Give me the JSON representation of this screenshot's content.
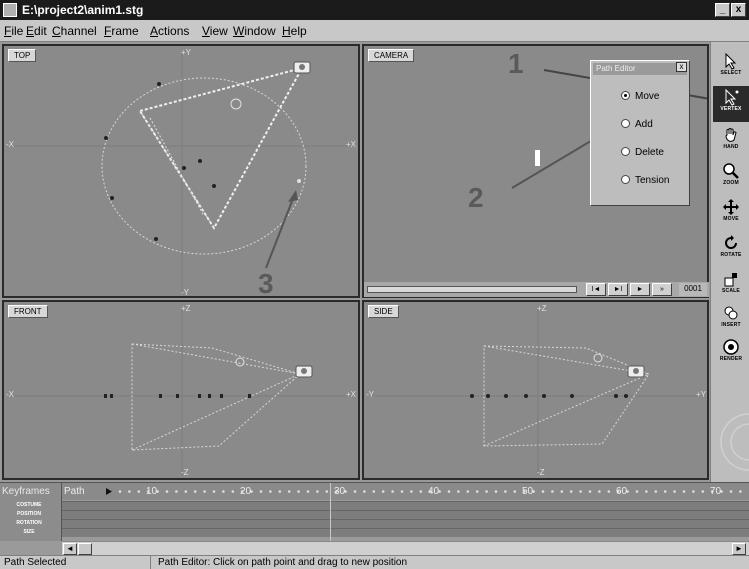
{
  "window": {
    "title": "E:\\project2\\anim1.stg",
    "minimize_glyph": "_",
    "close_glyph": "x"
  },
  "menu": [
    "File",
    "Edit",
    "Channel",
    "Frame",
    "Actions",
    "View",
    "Window",
    "Help"
  ],
  "viewports": {
    "top": {
      "label": "TOP",
      "axis_top": "+Y",
      "axis_bottom": "-Y",
      "axis_left": "-X",
      "axis_right": "+X"
    },
    "camera": {
      "label": "CAMERA"
    },
    "front": {
      "label": "FRONT",
      "axis_top": "+Z",
      "axis_bottom": "-Z",
      "axis_left": "-X",
      "axis_right": "+X"
    },
    "side": {
      "label": "SIDE",
      "axis_top": "+Z",
      "axis_bottom": "-Z",
      "axis_left": "-Y",
      "axis_right": "+Y"
    }
  },
  "callouts": [
    "1",
    "2",
    "3"
  ],
  "path_editor": {
    "title": "Path Editor",
    "close_glyph": "x",
    "options": [
      "Move",
      "Add",
      "Delete",
      "Tension"
    ],
    "selected": "Move"
  },
  "camera_timeline": {
    "frame": "0001",
    "buttons": [
      "I◄",
      "►I",
      "►",
      "»"
    ]
  },
  "toolbar": {
    "tools": [
      "SELECT",
      "VERTEX",
      "HAND",
      "ZOOM",
      "MOVE",
      "ROTATE",
      "SCALE",
      "INSERT",
      "RENDER"
    ],
    "active": "VERTEX"
  },
  "keyframes": {
    "title": "Keyframes",
    "tracks": [
      "COSTUME",
      "POSITION",
      "ROTATION",
      "SIZE"
    ],
    "path_label": "Path",
    "ruler": [
      "10",
      "20",
      "30",
      "40",
      "50",
      "60",
      "70"
    ]
  },
  "status": {
    "left": "Path Selected",
    "right": "Path Editor: Click on path point and drag to new position"
  },
  "colors": {
    "titlebar": "#1b1b1b",
    "viewport_bg": "#8a8a8a",
    "path_dots": "#e6e6e6",
    "callout": "#5a5a5a"
  }
}
